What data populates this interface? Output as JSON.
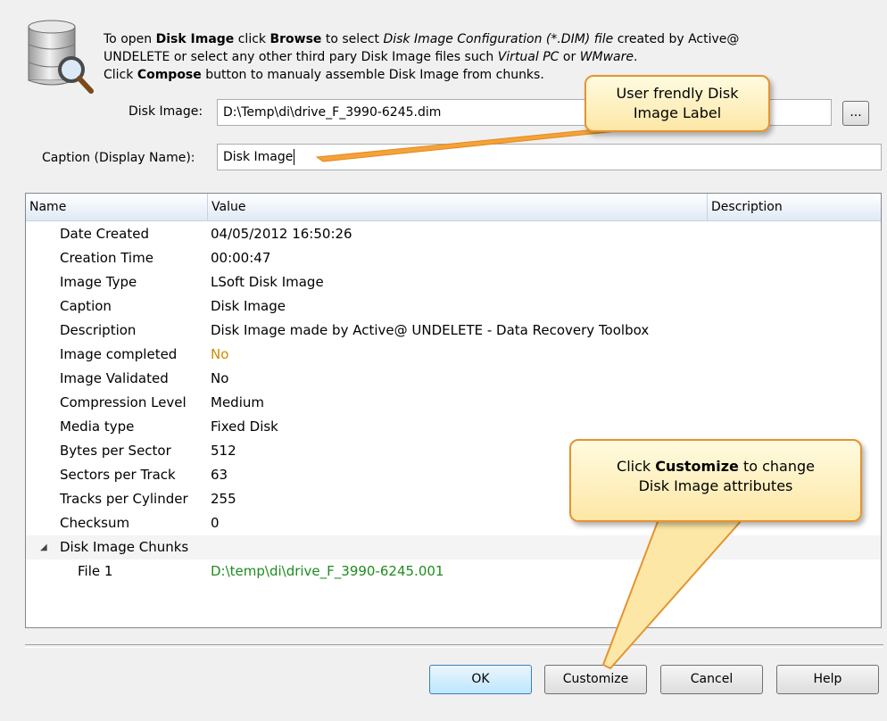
{
  "header": {
    "line1_pre": "To open ",
    "line1_b1": "Disk Image",
    "line1_mid": " click ",
    "line1_b2": "Browse",
    "line1_mid2": " to select ",
    "line1_i1": "Disk Image Configuration (*.DIM) file",
    "line1_post": " created by Active@",
    "line2_pre": "UNDELETE or select any other third pary Disk Image files such ",
    "line2_i1": "Virtual PC",
    "line2_mid": " or ",
    "line2_i2": "WMware",
    "line2_post": ".",
    "line3_pre": "Click ",
    "line3_b": "Compose",
    "line3_post": " button to manualy assemble Disk Image from chunks."
  },
  "disk_image": {
    "label": "Disk Image:",
    "value": "D:\\Temp\\di\\drive_F_3990-6245.dim",
    "browse_label": "..."
  },
  "caption": {
    "label": "Caption (Display Name):",
    "value": "Disk Image"
  },
  "grid": {
    "columns": [
      "Name",
      "Value",
      "Description"
    ],
    "rows": [
      {
        "name": "Date Created",
        "value": "04/05/2012 16:50:26"
      },
      {
        "name": "Creation Time",
        "value": "00:00:47"
      },
      {
        "name": "Image Type",
        "value": "LSoft Disk Image"
      },
      {
        "name": "Caption",
        "value": "Disk Image"
      },
      {
        "name": "Description",
        "value": "Disk Image made by Active@ UNDELETE - Data Recovery Toolbox"
      },
      {
        "name": "Image completed",
        "value": "No"
      },
      {
        "name": "Image Validated",
        "value": "No"
      },
      {
        "name": "Compression Level",
        "value": "Medium"
      },
      {
        "name": "Media type",
        "value": "Fixed Disk"
      },
      {
        "name": "Bytes per Sector",
        "value": "512"
      },
      {
        "name": "Sectors per Track",
        "value": "63"
      },
      {
        "name": "Tracks per Cylinder",
        "value": "255"
      },
      {
        "name": "Checksum",
        "value": "0"
      }
    ],
    "group": {
      "name": "Disk Image Chunks",
      "expander_icon": "triangle-expanded-icon"
    },
    "chunks": [
      {
        "name": "File 1",
        "value": "D:\\temp\\di\\drive_F_3990-6245.001"
      }
    ]
  },
  "buttons": {
    "ok": "OK",
    "customize": "Customize",
    "cancel": "Cancel",
    "help": "Help"
  },
  "callouts": {
    "label_tip": {
      "line1": "User frendly Disk",
      "line2": "Image Label"
    },
    "customize_tip": {
      "pre": "Click ",
      "bold": "Customize",
      "post": " to change",
      "line2": "Disk Image attributes"
    }
  },
  "colors": {
    "value_warning": "#d08a00",
    "value_path": "#1e8c1e",
    "callout_border": "#e59331",
    "pointer": "#f0901e"
  }
}
